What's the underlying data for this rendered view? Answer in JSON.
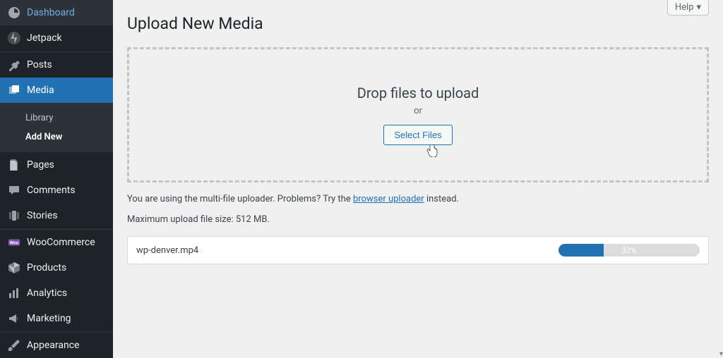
{
  "sidebar": {
    "items": [
      {
        "label": "Dashboard"
      },
      {
        "label": "Jetpack"
      },
      {
        "label": "Posts"
      },
      {
        "label": "Media"
      },
      {
        "label": "Pages"
      },
      {
        "label": "Comments"
      },
      {
        "label": "Stories"
      },
      {
        "label": "WooCommerce"
      },
      {
        "label": "Products"
      },
      {
        "label": "Analytics"
      },
      {
        "label": "Marketing"
      },
      {
        "label": "Appearance"
      }
    ],
    "media_submenu": [
      {
        "label": "Library"
      },
      {
        "label": "Add New"
      }
    ]
  },
  "header": {
    "page_title": "Upload New Media",
    "help_label": "Help"
  },
  "uploader": {
    "drop_text": "Drop files to upload",
    "or_text": "or",
    "select_btn": "Select Files",
    "note_prefix": "You are using the multi-file uploader. Problems? Try the ",
    "note_link": "browser uploader",
    "note_suffix": " instead.",
    "max_size": "Maximum upload file size: 512 MB."
  },
  "uploads": [
    {
      "filename": "wp-denver.mp4",
      "percent": 32,
      "percent_label": "32%"
    }
  ]
}
